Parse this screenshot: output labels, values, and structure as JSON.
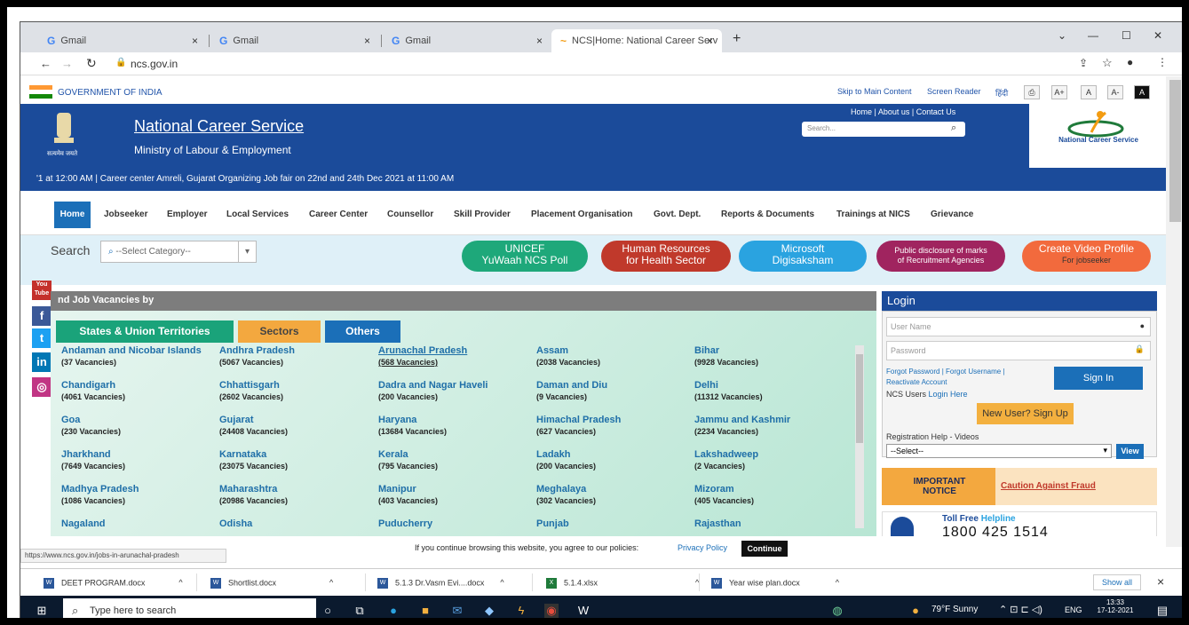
{
  "browser": {
    "tabs": [
      {
        "label": "Gmail",
        "close": "×"
      },
      {
        "label": "Gmail",
        "close": "×"
      },
      {
        "label": "Gmail",
        "close": "×"
      },
      {
        "label": "NCS|Home: National Career Serv",
        "close": "×"
      }
    ],
    "new_tab": "+",
    "url": "ncs.gov.in",
    "window_controls": [
      "⌄",
      "—",
      "☐",
      "✕"
    ]
  },
  "govbar": {
    "text": "GOVERNMENT OF INDIA",
    "skip": "Skip to Main Content",
    "reader": "Screen Reader",
    "hindi": "हिंदी",
    "sizes": [
      "A+",
      "A",
      "A-",
      "A"
    ]
  },
  "header": {
    "title": "National Career Service",
    "subtitle": "Ministry of Labour & Employment",
    "emblem_text": "सत्यमेव जयते",
    "toplinks": "Home | About us | Contact Us",
    "search_placeholder": "Search...",
    "logo_text": "National Career Service"
  },
  "ticker": "'1 at 12:00 AM   |   Career center Amreli, Gujarat Organizing Job fair on 22nd and 24th Dec 2021 at 11:00 AM",
  "nav": [
    "Home",
    "Jobseeker",
    "Employer",
    "Local Services",
    "Career Center",
    "Counsellor",
    "Skill Provider",
    "Placement Organisation",
    "Govt. Dept.",
    "Reports & Documents",
    "Trainings at NICS",
    "Grievance"
  ],
  "search": {
    "label": "Search",
    "placeholder": "--Select Category--",
    "pills": [
      {
        "l1": "UNICEF",
        "l2": "YuWaah NCS Poll",
        "color": "#1ea87a"
      },
      {
        "l1": "Human Resources",
        "l2": "for Health Sector",
        "color": "#c0392b"
      },
      {
        "l1": "Microsoft",
        "l2": "Digisaksham",
        "color": "#2aa3e0"
      },
      {
        "l1": "Public disclosure of marks",
        "l2": "of Recruitment Agencies",
        "color": "#a0245f"
      },
      {
        "l1": "Create Video Profile",
        "l2": "For jobseeker",
        "color": "#f26a3d"
      }
    ]
  },
  "social": [
    "You Tube",
    "f",
    "t",
    "in",
    "◎"
  ],
  "vacancies": {
    "heading": "nd Job Vacancies by",
    "tabs": [
      "States & Union Territories",
      "Sectors",
      "Others"
    ],
    "states": [
      {
        "name": "Andaman and Nicobar Islands",
        "count": "(37 Vacancies)"
      },
      {
        "name": "Andhra Pradesh",
        "count": "(5067 Vacancies)"
      },
      {
        "name": "Arunachal Pradesh",
        "count": "(568 Vacancies)"
      },
      {
        "name": "Assam",
        "count": "(2038 Vacancies)"
      },
      {
        "name": "Bihar",
        "count": "(9928 Vacancies)"
      },
      {
        "name": "Chandigarh",
        "count": "(4061 Vacancies)"
      },
      {
        "name": "Chhattisgarh",
        "count": "(2602 Vacancies)"
      },
      {
        "name": "Dadra and Nagar Haveli",
        "count": "(200 Vacancies)"
      },
      {
        "name": "Daman and Diu",
        "count": "(9 Vacancies)"
      },
      {
        "name": "Delhi",
        "count": "(11312 Vacancies)"
      },
      {
        "name": "Goa",
        "count": "(230 Vacancies)"
      },
      {
        "name": "Gujarat",
        "count": "(24408 Vacancies)"
      },
      {
        "name": "Haryana",
        "count": "(13684 Vacancies)"
      },
      {
        "name": "Himachal Pradesh",
        "count": "(627 Vacancies)"
      },
      {
        "name": "Jammu and Kashmir",
        "count": "(2234 Vacancies)"
      },
      {
        "name": "Jharkhand",
        "count": "(7649 Vacancies)"
      },
      {
        "name": "Karnataka",
        "count": "(23075 Vacancies)"
      },
      {
        "name": "Kerala",
        "count": "(795 Vacancies)"
      },
      {
        "name": "Ladakh",
        "count": "(200 Vacancies)"
      },
      {
        "name": "Lakshadweep",
        "count": "(2 Vacancies)"
      },
      {
        "name": "Madhya Pradesh",
        "count": "(1086 Vacancies)"
      },
      {
        "name": "Maharashtra",
        "count": "(20986 Vacancies)"
      },
      {
        "name": "Manipur",
        "count": "(403 Vacancies)"
      },
      {
        "name": "Meghalaya",
        "count": "(302 Vacancies)"
      },
      {
        "name": "Mizoram",
        "count": "(405 Vacancies)"
      },
      {
        "name": "Nagaland",
        "count": ""
      },
      {
        "name": "Odisha",
        "count": ""
      },
      {
        "name": "Puducherry",
        "count": ""
      },
      {
        "name": "Punjab",
        "count": ""
      },
      {
        "name": "Rajasthan",
        "count": ""
      }
    ]
  },
  "login": {
    "heading": "Login",
    "user_placeholder": "User Name",
    "pass_placeholder": "Password",
    "forgot": "Forgot Password | Forgot Username |",
    "reactivate": "Reactivate Account",
    "ncs_users": "NCS Users",
    "login_here": "Login Here",
    "signin": "Sign In",
    "new_user": "New User? Sign Up",
    "reg_help": "Registration Help - Videos",
    "select": "--Select--",
    "view": "View",
    "important_l1": "IMPORTANT",
    "important_l2": "NOTICE",
    "fraud": "Caution Against Fraud",
    "toll_label": "Toll Free",
    "helpline": "Helpline",
    "toll_number": "1800 425 1514"
  },
  "status_url": "https://www.ncs.gov.in/jobs-in-arunachal-pradesh",
  "cookie": {
    "text": "If you continue browsing this website, you agree to our policies:",
    "link": "Privacy Policy",
    "button": "Continue"
  },
  "downloads": {
    "items": [
      "DEET PROGRAM.docx",
      "Shortlist.docx",
      "5.1.3 Dr.Vasm Evi....docx",
      "5.1.4.xlsx",
      "Year wise plan.docx"
    ],
    "show_all": "Show all",
    "close": "×"
  },
  "taskbar": {
    "search": "Type here to search",
    "weather": "79°F  Sunny",
    "lang": "ENG",
    "time": "13:33",
    "date": "17-12-2021"
  }
}
